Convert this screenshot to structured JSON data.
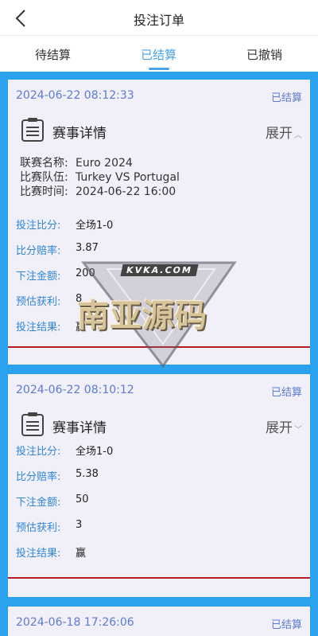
{
  "header": {
    "title": "投注订单"
  },
  "tabs": [
    {
      "label": "待结算"
    },
    {
      "label": "已结算"
    },
    {
      "label": "已撤销"
    }
  ],
  "orders": [
    {
      "time": "2024-06-22 08:12:33",
      "status": "已结算",
      "detail_title": "赛事详情",
      "expand_label": "展开",
      "match": {
        "league_label": "联赛名称:",
        "league": "Euro 2024",
        "teams_label": "比赛队伍:",
        "teams": "Turkey VS Portugal",
        "time_label": "比赛时间:",
        "time": "2024-06-22 16:00"
      },
      "rows": [
        {
          "label": "投注比分:",
          "value": "全场1-0"
        },
        {
          "label": "比分赔率:",
          "value": "3.87"
        },
        {
          "label": "下注金额:",
          "value": "200"
        },
        {
          "label": "预估获利:",
          "value": "8"
        },
        {
          "label": "投注结果:",
          "value": "赢"
        }
      ]
    },
    {
      "time": "2024-06-22 08:10:12",
      "status": "已结算",
      "detail_title": "赛事详情",
      "expand_label": "展开",
      "rows": [
        {
          "label": "投注比分:",
          "value": "全场1-0"
        },
        {
          "label": "比分赔率:",
          "value": "5.38"
        },
        {
          "label": "下注金额:",
          "value": "50"
        },
        {
          "label": "预估获利:",
          "value": "3"
        },
        {
          "label": "投注结果:",
          "value": "赢"
        }
      ]
    },
    {
      "time": "2024-06-18 17:26:06",
      "status": "已结算"
    }
  ],
  "watermark": {
    "top_text": "KVKA.COM",
    "main_text": "南亚源码"
  },
  "colors": {
    "accent": "#4aa3e8",
    "list_bg": "#2ba2ee",
    "card_bg": "#f1eff8",
    "label_blue": "#2f86d6",
    "divider_red": "#b21c22"
  }
}
